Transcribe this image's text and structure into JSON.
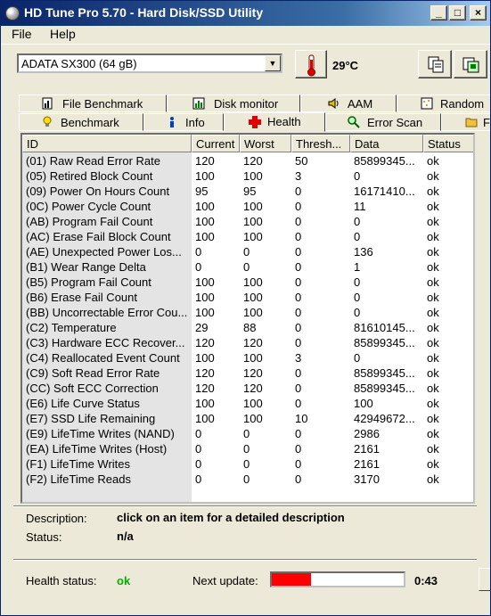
{
  "window": {
    "title": "HD Tune Pro 5.70 - Hard Disk/SSD Utility"
  },
  "menu": {
    "file": "File",
    "help": "Help"
  },
  "toolbar": {
    "drive": "ADATA SX300 (64 gB)",
    "temperature": "29°C"
  },
  "tabs_top": [
    {
      "label": "File Benchmark",
      "icon": "file-benchmark-icon"
    },
    {
      "label": "Disk monitor",
      "icon": "disk-monitor-icon"
    },
    {
      "label": "AAM",
      "icon": "speaker-icon"
    },
    {
      "label": "Random",
      "icon": "random-access-icon"
    }
  ],
  "tabs_bottom": [
    {
      "label": "Benchmark",
      "icon": "lightbulb-icon"
    },
    {
      "label": "Info",
      "icon": "info-icon"
    },
    {
      "label": "Health",
      "icon": "health-cross-icon"
    },
    {
      "label": "Error Scan",
      "icon": "magnifier-icon"
    },
    {
      "label": "F",
      "icon": "folder-icon"
    }
  ],
  "table": {
    "columns": [
      "ID",
      "Current",
      "Worst",
      "Thresh...",
      "Data",
      "Status"
    ],
    "rows": [
      [
        "(01) Raw Read Error Rate",
        "120",
        "120",
        "50",
        "85899345...",
        "ok"
      ],
      [
        "(05) Retired Block Count",
        "100",
        "100",
        "3",
        "0",
        "ok"
      ],
      [
        "(09) Power On Hours Count",
        "95",
        "95",
        "0",
        "16171410...",
        "ok"
      ],
      [
        "(0C) Power Cycle Count",
        "100",
        "100",
        "0",
        "11",
        "ok"
      ],
      [
        "(AB) Program Fail Count",
        "100",
        "100",
        "0",
        "0",
        "ok"
      ],
      [
        "(AC) Erase Fail Block Count",
        "100",
        "100",
        "0",
        "0",
        "ok"
      ],
      [
        "(AE) Unexpected Power Los...",
        "0",
        "0",
        "0",
        "136",
        "ok"
      ],
      [
        "(B1) Wear Range Delta",
        "0",
        "0",
        "0",
        "1",
        "ok"
      ],
      [
        "(B5) Program Fail Count",
        "100",
        "100",
        "0",
        "0",
        "ok"
      ],
      [
        "(B6) Erase Fail Count",
        "100",
        "100",
        "0",
        "0",
        "ok"
      ],
      [
        "(BB) Uncorrectable Error Cou...",
        "100",
        "100",
        "0",
        "0",
        "ok"
      ],
      [
        "(C2) Temperature",
        "29",
        "88",
        "0",
        "81610145...",
        "ok"
      ],
      [
        "(C3) Hardware ECC Recover...",
        "120",
        "120",
        "0",
        "85899345...",
        "ok"
      ],
      [
        "(C4) Reallocated Event Count",
        "100",
        "100",
        "3",
        "0",
        "ok"
      ],
      [
        "(C9) Soft Read Error Rate",
        "120",
        "120",
        "0",
        "85899345...",
        "ok"
      ],
      [
        "(CC) Soft ECC Correction",
        "120",
        "120",
        "0",
        "85899345...",
        "ok"
      ],
      [
        "(E6) Life Curve Status",
        "100",
        "100",
        "0",
        "100",
        "ok"
      ],
      [
        "(E7) SSD Life Remaining",
        "100",
        "100",
        "10",
        "42949672...",
        "ok"
      ],
      [
        "(E9) LifeTime Writes (NAND)",
        "0",
        "0",
        "0",
        "2986",
        "ok"
      ],
      [
        "(EA) LifeTime Writes (Host)",
        "0",
        "0",
        "0",
        "2161",
        "ok"
      ],
      [
        "(F1) LifeTime Writes",
        "0",
        "0",
        "0",
        "2161",
        "ok"
      ],
      [
        "(F2) LifeTime Reads",
        "0",
        "0",
        "0",
        "3170",
        "ok"
      ]
    ]
  },
  "footer": {
    "description_label": "Description:",
    "description_value": "click on an item for a detailed description",
    "status_label": "Status:",
    "status_value": "n/a",
    "health_label": "Health status:",
    "health_value": "ok",
    "next_update_label": "Next update:",
    "next_update_progress": 0.3,
    "countdown": "0:43"
  },
  "colors": {
    "health_ok": "#00b000",
    "progress": "#ff0000",
    "title_bar": "#0a246a"
  }
}
